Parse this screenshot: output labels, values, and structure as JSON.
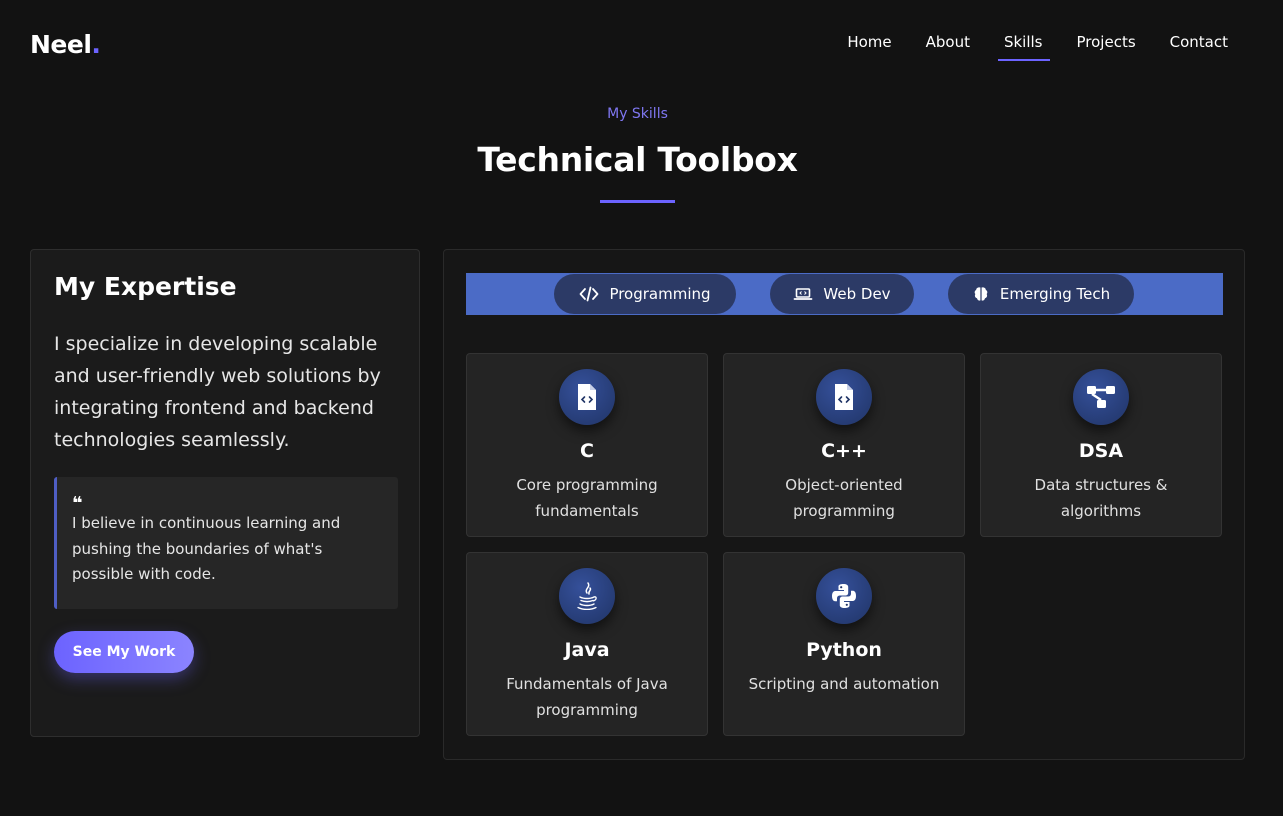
{
  "brand": {
    "name": "Neel",
    "dot": "."
  },
  "nav": [
    "Home",
    "About",
    "Skills",
    "Projects",
    "Contact"
  ],
  "nav_active": "Skills",
  "header": {
    "eyebrow": "My Skills",
    "title": "Technical Toolbox"
  },
  "expertise": {
    "title": "My Expertise",
    "description": "I specialize in developing scalable and user-friendly web solutions by integrating frontend and backend technologies seamlessly.",
    "quote_mark": "❝",
    "quote": "I believe in continuous learning and pushing the boundaries of what's possible with code.",
    "button": "See My Work"
  },
  "tabs": [
    {
      "label": "Programming",
      "icon": "code-icon"
    },
    {
      "label": "Web Dev",
      "icon": "laptop-code-icon"
    },
    {
      "label": "Emerging Tech",
      "icon": "brain-icon"
    }
  ],
  "skills": [
    {
      "name": "C",
      "description": "Core programming fundamentals",
      "icon": "file-code-icon"
    },
    {
      "name": "C++",
      "description": "Object-oriented programming",
      "icon": "file-code-icon"
    },
    {
      "name": "DSA",
      "description": "Data structures & algorithms",
      "icon": "sitemap-icon"
    },
    {
      "name": "Java",
      "description": "Fundamentals of Java programming",
      "icon": "java-icon"
    },
    {
      "name": "Python",
      "description": "Scripting and automation",
      "icon": "python-icon"
    }
  ],
  "colors": {
    "accent": "#6c63ff",
    "tabbar": "#4b6bc6",
    "background": "#121212"
  }
}
